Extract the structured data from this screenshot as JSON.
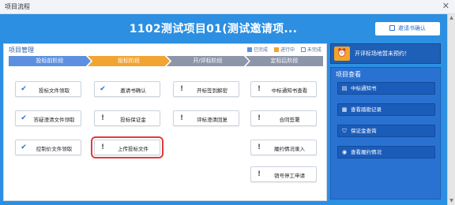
{
  "window": {
    "title": "项目流程",
    "close_glyph": "✕"
  },
  "header": {
    "project_title": "1102测试项目01(测试邀请项...",
    "invite_confirm_label": "邀请书确认"
  },
  "main": {
    "title": "项目管理",
    "legend": {
      "completed": "已完成",
      "in_progress": "进行中",
      "not_done": "未完成"
    },
    "stages": [
      "投标前阶段",
      "投标阶段",
      "开/评标阶段",
      "定标后阶段"
    ],
    "tasks": {
      "t1": "投标文件领取",
      "t2": "答疑澄清文件领取",
      "t3": "控制价文件领取",
      "t4": "邀请书确认",
      "t5": "投标保证金",
      "t6": "上传投标文件",
      "t7": "开标签到解密",
      "t8": "评标澄清回复",
      "t9": "中标通知书查看",
      "t10": "合同签署",
      "t11": "履约情况录入",
      "t12": "销号停工申请"
    }
  },
  "notice": {
    "text": "开评标场地暂未预约！"
  },
  "query": {
    "title": "项目查看",
    "items": [
      "中标通知书",
      "查看踏勘记录",
      "保证金查询",
      "查看履约情况"
    ]
  },
  "colors": {
    "frame_blue": "#2c8fe2",
    "stage_done": "#5d8fe0",
    "stage_active": "#f2a431",
    "stage_pending": "#8d96a8",
    "highlight": "#e23b3b"
  }
}
